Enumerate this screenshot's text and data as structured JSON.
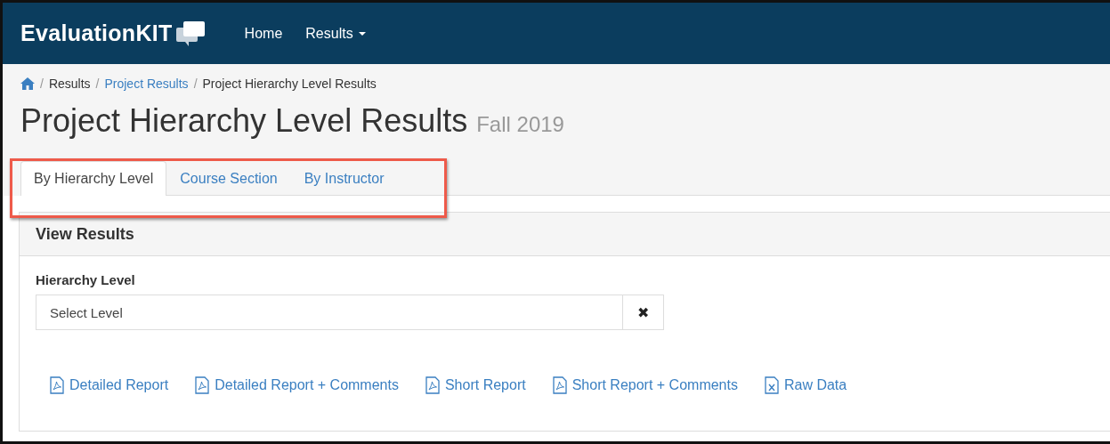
{
  "navbar": {
    "brand": "EvaluationKIT",
    "items": [
      {
        "label": "Home",
        "dropdown": false
      },
      {
        "label": "Results",
        "dropdown": true
      }
    ]
  },
  "breadcrumb": [
    {
      "separator": "/",
      "label": "Results",
      "link": false
    },
    {
      "separator": "/",
      "label": "Project Results",
      "link": true
    },
    {
      "separator": "/",
      "label": "Project Hierarchy Level Results",
      "link": false
    }
  ],
  "page_title": "Project Hierarchy Level Results",
  "page_subtitle": "Fall 2019",
  "tabs": [
    {
      "label": "By Hierarchy Level",
      "selected": true
    },
    {
      "label": "Course Section",
      "selected": false
    },
    {
      "label": "By Instructor",
      "selected": false
    }
  ],
  "panel": {
    "heading": "View Results",
    "field_label": "Hierarchy Level",
    "select": {
      "placeholder": "Select Level",
      "clear": "✖"
    },
    "reports": [
      {
        "label": "Detailed Report",
        "kind": "pdf"
      },
      {
        "label": "Detailed Report + Comments",
        "kind": "pdf"
      },
      {
        "label": "Short Report",
        "kind": "pdf"
      },
      {
        "label": "Short Report + Comments",
        "kind": "pdf"
      },
      {
        "label": "Raw Data",
        "kind": "excel"
      }
    ]
  }
}
